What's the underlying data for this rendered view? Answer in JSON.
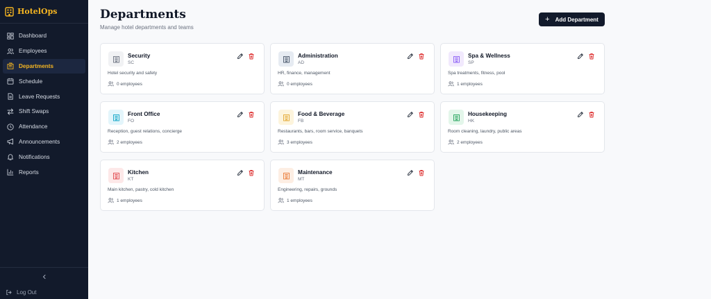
{
  "app": {
    "name": "HotelOps"
  },
  "sidebar": {
    "items": [
      {
        "label": "Dashboard",
        "icon": "dashboard-icon"
      },
      {
        "label": "Employees",
        "icon": "users-icon"
      },
      {
        "label": "Departments",
        "icon": "building-icon",
        "active": true
      },
      {
        "label": "Schedule",
        "icon": "calendar-icon"
      },
      {
        "label": "Leave Requests",
        "icon": "document-icon"
      },
      {
        "label": "Shift Swaps",
        "icon": "swap-icon"
      },
      {
        "label": "Attendance",
        "icon": "clock-icon"
      },
      {
        "label": "Announcements",
        "icon": "megaphone-icon"
      },
      {
        "label": "Notifications",
        "icon": "bell-icon"
      },
      {
        "label": "Reports",
        "icon": "bar-chart-icon"
      }
    ],
    "collapse_icon": "chevron-left-icon",
    "logout_label": "Log Out"
  },
  "header": {
    "title": "Departments",
    "subtitle": "Manage hotel departments and teams",
    "add_button_label": "Add Department"
  },
  "departments": [
    {
      "name": "Security",
      "code": "SC",
      "description": "Hotel security and safety",
      "employees": "0 employees",
      "icon_bg": "#f1f2f4",
      "icon_color": "#6b7280"
    },
    {
      "name": "Administration",
      "code": "AD",
      "description": "HR, finance, management",
      "employees": "0 employees",
      "icon_bg": "#e6ebf2",
      "icon_color": "#475569"
    },
    {
      "name": "Spa & Wellness",
      "code": "SP",
      "description": "Spa treatments, fitness, pool",
      "employees": "1 employees",
      "icon_bg": "#f1e9fd",
      "icon_color": "#8b5cf6"
    },
    {
      "name": "Front Office",
      "code": "FO",
      "description": "Reception, guest relations, concierge",
      "employees": "2 employees",
      "icon_bg": "#e3f5fb",
      "icon_color": "#0ea5c6"
    },
    {
      "name": "Food & Beverage",
      "code": "FB",
      "description": "Restaurants, bars, room service, banquets",
      "employees": "3 employees",
      "icon_bg": "#fdf4dc",
      "icon_color": "#e3a72f"
    },
    {
      "name": "Housekeeping",
      "code": "HK",
      "description": "Room cleaning, laundry, public areas",
      "employees": "2 employees",
      "icon_bg": "#e3f6ea",
      "icon_color": "#22a35a"
    },
    {
      "name": "Kitchen",
      "code": "KT",
      "description": "Main kitchen, pastry, cold kitchen",
      "employees": "1 employees",
      "icon_bg": "#fde8e8",
      "icon_color": "#e0474c"
    },
    {
      "name": "Maintenance",
      "code": "MT",
      "description": "Engineering, repairs, grounds",
      "employees": "1 employees",
      "icon_bg": "#fdeee3",
      "icon_color": "#ea7a35"
    }
  ],
  "colors": {
    "sidebar_bg": "#121a2b",
    "accent": "#f5b521",
    "primary_button": "#121a2b",
    "delete": "#dc2626"
  }
}
